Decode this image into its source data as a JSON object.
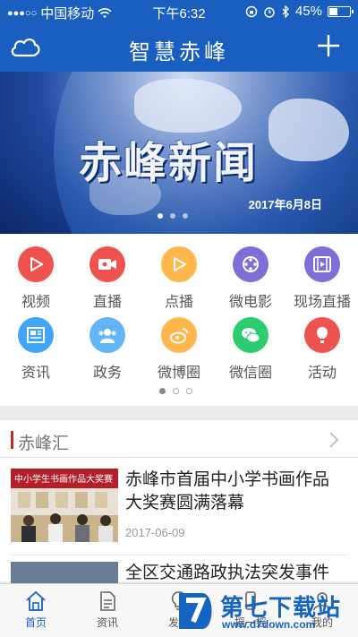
{
  "status_bar": {
    "signal": "●●●○○",
    "carrier": "中国移动",
    "time": "下午6:32",
    "battery": "45%",
    "battery_level": 0.45
  },
  "nav": {
    "title": "智慧赤峰",
    "left_icon": "cloud-icon",
    "right_icon": "plus-icon"
  },
  "banner": {
    "title": "赤峰新闻",
    "date": "2017年6月8日",
    "slide_count": 3,
    "active_slide": 0
  },
  "grid": {
    "rows": [
      [
        {
          "label": "视频",
          "icon": "play-triangle-icon",
          "color": "#ef5350"
        },
        {
          "label": "直播",
          "icon": "video-camera-icon",
          "color": "#ef5350"
        },
        {
          "label": "点播",
          "icon": "play-triangle-icon",
          "color": "#ffb74d"
        },
        {
          "label": "微电影",
          "icon": "film-reel-icon",
          "color": "#7e6fd6"
        },
        {
          "label": "现场直播",
          "icon": "film-strip-icon",
          "color": "#7e6fd6"
        }
      ],
      [
        {
          "label": "资讯",
          "icon": "newspaper-icon",
          "color": "#42a5f5"
        },
        {
          "label": "政务",
          "icon": "people-icon",
          "color": "#64b5f6"
        },
        {
          "label": "微博圈",
          "icon": "weibo-icon",
          "color": "#ffb74d"
        },
        {
          "label": "微信圈",
          "icon": "wechat-icon",
          "color": "#2ecc71"
        },
        {
          "label": "活动",
          "icon": "hot-air-balloon-icon",
          "color": "#ef5350"
        }
      ]
    ],
    "page_count": 3,
    "active_page": 0
  },
  "section": {
    "title": "赤峰汇",
    "items": [
      {
        "title": "赤峰市首届中小学书画作品大奖赛圆满落幕",
        "date": "2017-06-09",
        "thumb_text": "中小学生书画作品大奖赛"
      },
      {
        "title": "全区交通路政执法突发事件演练",
        "date": ""
      }
    ]
  },
  "tabs": [
    {
      "label": "首页",
      "icon": "home-icon",
      "active": true
    },
    {
      "label": "资讯",
      "icon": "document-icon",
      "active": false
    },
    {
      "label": "发现",
      "icon": "lightbulb-icon",
      "active": false
    },
    {
      "label": "摇一摇",
      "icon": "phone-shake-icon",
      "active": false
    },
    {
      "label": "我的",
      "icon": "person-icon",
      "active": false
    }
  ],
  "watermark": {
    "text": "第七下载站",
    "url": "www.d7down.com"
  }
}
